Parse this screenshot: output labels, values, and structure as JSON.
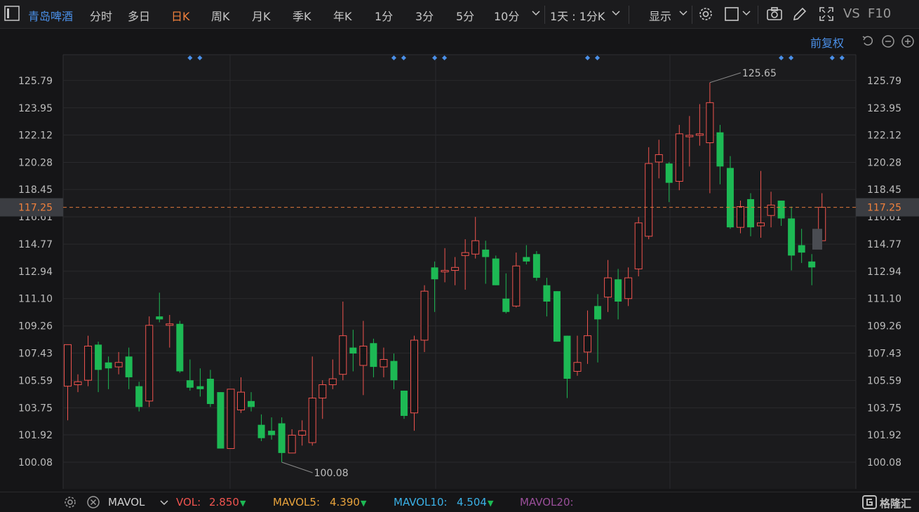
{
  "toolbar": {
    "stock_name": "青岛啤酒",
    "tabs": [
      "分时",
      "多日",
      "日K",
      "周K",
      "月K",
      "季K",
      "年K",
      "1分",
      "3分",
      "5分",
      "10分"
    ],
    "active_tab": "日K",
    "interval_label": "1天 : 1分K",
    "display_label": "显示",
    "vs_label": "VS",
    "f10_label": "F10"
  },
  "chart_header": {
    "adjust_label": "前复权"
  },
  "axis": {
    "y_ticks": [
      "125.79",
      "123.95",
      "122.12",
      "120.28",
      "118.45",
      "116.61",
      "114.77",
      "112.94",
      "111.10",
      "109.26",
      "107.43",
      "105.59",
      "103.75",
      "101.92",
      "100.08"
    ],
    "current_price": "117.25",
    "max_label": "125.65",
    "min_label": "100.08"
  },
  "chart_data": {
    "type": "candlestick",
    "ylim": [
      100.08,
      125.79
    ],
    "current_price": 117.25,
    "max": 125.65,
    "min": 100.08,
    "colors": {
      "up": "#f0544f",
      "down": "#1db954",
      "grid": "#2a2a2d",
      "dots": "#4a8fe7"
    },
    "candles": [
      {
        "o": 105.2,
        "c": 108.0,
        "h": 108.0,
        "l": 102.9
      },
      {
        "o": 105.3,
        "c": 105.5,
        "h": 106.0,
        "l": 104.8
      },
      {
        "o": 105.6,
        "c": 107.9,
        "h": 108.6,
        "l": 105.2
      },
      {
        "o": 108.0,
        "c": 106.3,
        "h": 108.2,
        "l": 104.8
      },
      {
        "o": 106.8,
        "c": 106.4,
        "h": 107.2,
        "l": 105.0
      },
      {
        "o": 106.5,
        "c": 106.8,
        "h": 107.5,
        "l": 106.0
      },
      {
        "o": 107.2,
        "c": 105.8,
        "h": 107.8,
        "l": 105.0
      },
      {
        "o": 105.2,
        "c": 103.8,
        "h": 105.5,
        "l": 103.5
      },
      {
        "o": 104.2,
        "c": 109.3,
        "h": 109.9,
        "l": 103.8
      },
      {
        "o": 109.9,
        "c": 109.7,
        "h": 111.5,
        "l": 109.5
      },
      {
        "o": 109.3,
        "c": 109.4,
        "h": 110.0,
        "l": 107.8
      },
      {
        "o": 109.4,
        "c": 106.2,
        "h": 109.6,
        "l": 106.1
      },
      {
        "o": 105.6,
        "c": 105.1,
        "h": 107.0,
        "l": 104.9
      },
      {
        "o": 105.2,
        "c": 105.0,
        "h": 106.4,
        "l": 104.5
      },
      {
        "o": 105.7,
        "c": 104.0,
        "h": 106.3,
        "l": 103.8
      },
      {
        "o": 104.8,
        "c": 101.0,
        "h": 104.8,
        "l": 101.0
      },
      {
        "o": 101.0,
        "c": 105.0,
        "h": 105.0,
        "l": 101.0
      },
      {
        "o": 103.6,
        "c": 104.8,
        "h": 105.8,
        "l": 103.4
      },
      {
        "o": 104.2,
        "c": 103.8,
        "h": 104.8,
        "l": 103.5
      },
      {
        "o": 102.6,
        "c": 101.7,
        "h": 103.3,
        "l": 101.5
      },
      {
        "o": 102.2,
        "c": 101.9,
        "h": 103.1,
        "l": 101.6
      },
      {
        "o": 102.7,
        "c": 100.7,
        "h": 103.1,
        "l": 100.08
      },
      {
        "o": 100.7,
        "c": 101.9,
        "h": 102.3,
        "l": 100.7
      },
      {
        "o": 101.9,
        "c": 102.2,
        "h": 102.9,
        "l": 101.2
      },
      {
        "o": 101.4,
        "c": 104.4,
        "h": 107.2,
        "l": 101.2
      },
      {
        "o": 104.4,
        "c": 105.3,
        "h": 105.6,
        "l": 103.0
      },
      {
        "o": 105.3,
        "c": 105.7,
        "h": 107.0,
        "l": 105.0
      },
      {
        "o": 106.0,
        "c": 108.6,
        "h": 110.9,
        "l": 105.6
      },
      {
        "o": 107.8,
        "c": 107.4,
        "h": 109.0,
        "l": 106.2
      },
      {
        "o": 106.6,
        "c": 107.9,
        "h": 109.6,
        "l": 104.6
      },
      {
        "o": 108.1,
        "c": 106.5,
        "h": 108.4,
        "l": 105.8
      },
      {
        "o": 106.5,
        "c": 107.0,
        "h": 107.8,
        "l": 105.8
      },
      {
        "o": 106.9,
        "c": 105.6,
        "h": 107.4,
        "l": 105.0
      },
      {
        "o": 104.9,
        "c": 103.2,
        "h": 104.9,
        "l": 103.0
      },
      {
        "o": 103.4,
        "c": 108.3,
        "h": 108.6,
        "l": 102.2
      },
      {
        "o": 108.3,
        "c": 111.6,
        "h": 112.0,
        "l": 107.5
      },
      {
        "o": 113.2,
        "c": 112.4,
        "h": 113.6,
        "l": 110.2
      },
      {
        "o": 112.9,
        "c": 113.0,
        "h": 114.5,
        "l": 112.2
      },
      {
        "o": 113.0,
        "c": 113.2,
        "h": 113.9,
        "l": 112.0
      },
      {
        "o": 114.0,
        "c": 114.2,
        "h": 115.1,
        "l": 111.7
      },
      {
        "o": 114.1,
        "c": 115.0,
        "h": 116.6,
        "l": 113.8
      },
      {
        "o": 114.4,
        "c": 113.9,
        "h": 115.0,
        "l": 112.1
      },
      {
        "o": 113.8,
        "c": 112.0,
        "h": 114.0,
        "l": 112.0
      },
      {
        "o": 111.1,
        "c": 110.2,
        "h": 112.8,
        "l": 110.1
      },
      {
        "o": 110.6,
        "c": 113.3,
        "h": 114.2,
        "l": 110.5
      },
      {
        "o": 113.9,
        "c": 113.6,
        "h": 114.7,
        "l": 113.4
      },
      {
        "o": 114.1,
        "c": 112.5,
        "h": 114.3,
        "l": 112.3
      },
      {
        "o": 112.0,
        "c": 110.9,
        "h": 112.5,
        "l": 109.9
      },
      {
        "o": 111.6,
        "c": 108.2,
        "h": 111.6,
        "l": 108.2
      },
      {
        "o": 108.6,
        "c": 105.7,
        "h": 108.6,
        "l": 104.4
      },
      {
        "o": 106.2,
        "c": 106.8,
        "h": 108.6,
        "l": 105.9
      },
      {
        "o": 107.5,
        "c": 108.6,
        "h": 110.3,
        "l": 106.7
      },
      {
        "o": 110.6,
        "c": 109.7,
        "h": 111.4,
        "l": 106.8
      },
      {
        "o": 111.2,
        "c": 112.5,
        "h": 113.7,
        "l": 110.2
      },
      {
        "o": 112.4,
        "c": 110.9,
        "h": 113.1,
        "l": 109.7
      },
      {
        "o": 111.1,
        "c": 112.5,
        "h": 113.2,
        "l": 110.6
      },
      {
        "o": 113.1,
        "c": 116.2,
        "h": 116.6,
        "l": 112.6
      },
      {
        "o": 115.3,
        "c": 120.2,
        "h": 121.3,
        "l": 115.1
      },
      {
        "o": 120.3,
        "c": 120.8,
        "h": 121.8,
        "l": 119.2
      },
      {
        "o": 120.2,
        "c": 118.9,
        "h": 120.3,
        "l": 117.6
      },
      {
        "o": 119.0,
        "c": 122.2,
        "h": 122.8,
        "l": 118.4
      },
      {
        "o": 122.0,
        "c": 122.1,
        "h": 123.4,
        "l": 120.0
      },
      {
        "o": 122.1,
        "c": 122.2,
        "h": 124.2,
        "l": 121.4
      },
      {
        "o": 121.6,
        "c": 124.3,
        "h": 125.65,
        "l": 118.2
      },
      {
        "o": 122.3,
        "c": 120.0,
        "h": 122.8,
        "l": 118.8
      },
      {
        "o": 119.9,
        "c": 115.9,
        "h": 120.7,
        "l": 115.8
      },
      {
        "o": 115.9,
        "c": 117.3,
        "h": 117.7,
        "l": 115.5
      },
      {
        "o": 117.8,
        "c": 115.9,
        "h": 118.2,
        "l": 115.3
      },
      {
        "o": 116.0,
        "c": 116.2,
        "h": 119.7,
        "l": 115.2
      },
      {
        "o": 116.7,
        "c": 117.4,
        "h": 118.3,
        "l": 115.9
      },
      {
        "o": 117.7,
        "c": 116.5,
        "h": 117.7,
        "l": 116.0
      },
      {
        "o": 116.5,
        "c": 114.0,
        "h": 117.3,
        "l": 113.0
      },
      {
        "o": 114.7,
        "c": 114.2,
        "h": 115.8,
        "l": 113.5
      },
      {
        "o": 113.6,
        "c": 113.2,
        "h": 114.1,
        "l": 112.0
      },
      {
        "o": 115.0,
        "c": 117.25,
        "h": 118.2,
        "l": 115.0
      }
    ],
    "marker_candles": [
      12,
      32,
      36,
      51,
      70,
      75
    ],
    "pending_candle": {
      "top": 115.8,
      "bottom": 114.4
    }
  },
  "footer": {
    "indicator": "MAVOL",
    "vol_label": "VOL:",
    "vol_value": "2.850",
    "mavol5_label": "MAVOL5:",
    "mavol5_value": "4.390",
    "mavol10_label": "MAVOL10:",
    "mavol10_value": "4.504",
    "mavol20_label": "MAVOL20:",
    "colors": {
      "vol": "#f0544f",
      "mavol5": "#e8a33c",
      "mavol10": "#3ab1e7",
      "mavol20": "#9a4f9a",
      "arrow": "#1db954"
    }
  },
  "watermark": "格隆汇"
}
